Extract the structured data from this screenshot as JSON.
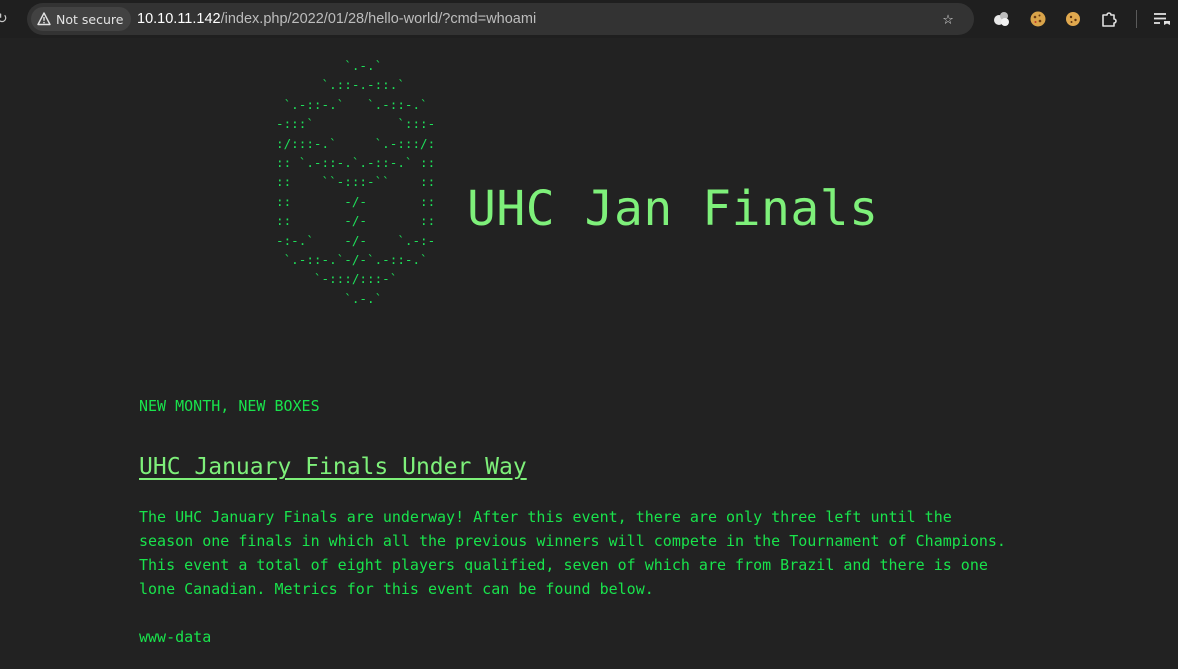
{
  "browser": {
    "security_label": "Not secure",
    "url_host": "10.10.11.142",
    "url_path": "/index.php/2022/01/28/hello-world/?cmd=whoami",
    "toolbar_icons": [
      "extension-cloud-icon",
      "cookie-extension-icon",
      "cookie-icon",
      "extensions-puzzle-icon",
      "reading-list-icon"
    ]
  },
  "page": {
    "ascii_logo": [
      "         `.-.`",
      "      `.::-.-::.`",
      " `.-::-.`   `.-::-.`",
      "-:::`           `:::-",
      ":/:::-.`     `.-:::/:",
      ":: `.-::-.`.-::-.` ::",
      "::    ``-:::-``    ::",
      "::       -/-       ::",
      "::       -/-       ::",
      "-:-.`    -/-    `.-:-",
      " `.-::-.`-/-`.-::-.`",
      "     `-:::/:::-`",
      "         `.-.`"
    ],
    "site_title": "UHC Jan Finals",
    "tagline": "NEW MONTH, NEW BOXES",
    "post_title": "UHC January Finals Under Way",
    "post_body": [
      "The UHC January Finals are underway! After this event, there are only three left until the",
      "season one finals in which all the previous winners will compete in the Tournament of Champions.",
      "This event a total of eight players qualified, seven of which are from Brazil and there is one",
      "lone Canadian. Metrics for this event can be found below."
    ],
    "command_output": "www-data"
  },
  "colors": {
    "background": "#222222",
    "text_green": "#19e34c",
    "title_green": "#7ef07a"
  }
}
